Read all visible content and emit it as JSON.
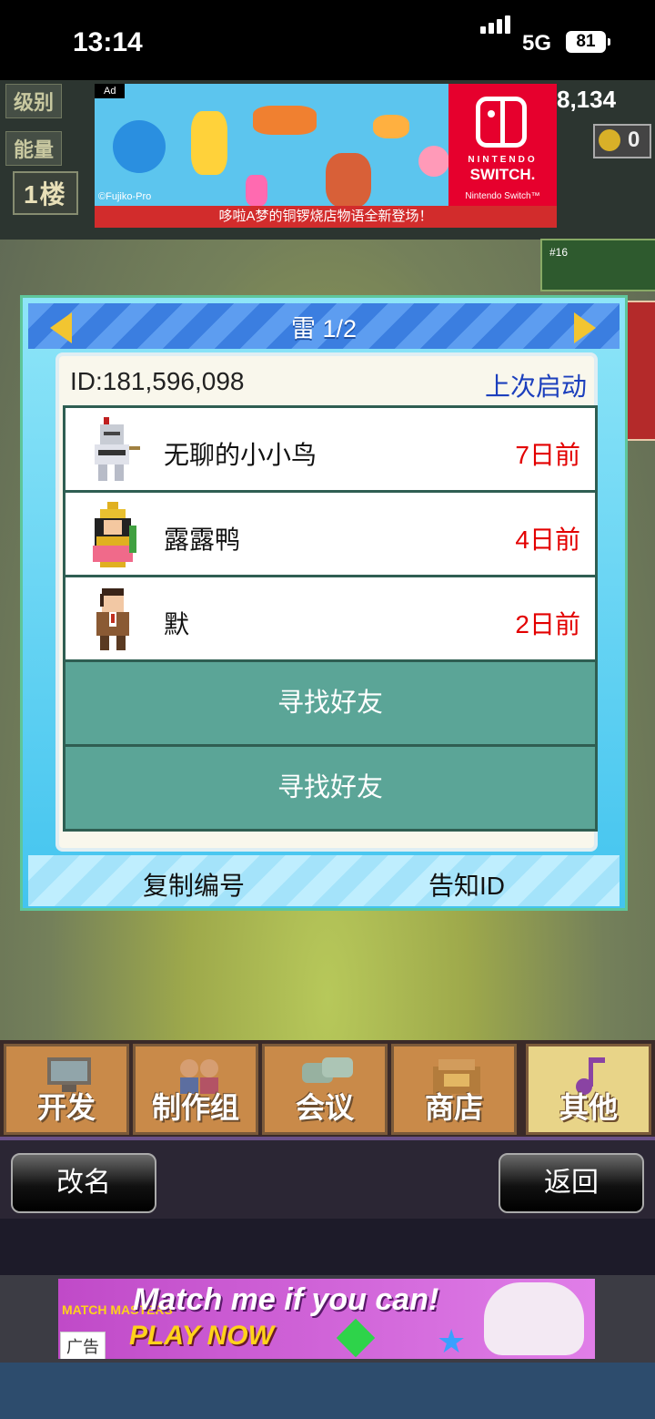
{
  "status_bar": {
    "time": "13:14",
    "network": "5G",
    "battery": "81"
  },
  "game_hud": {
    "level_label": "级别",
    "energy_label": "能量",
    "floor_label": "1楼",
    "money": "8,134",
    "coins": "0",
    "mini_badge": "#16"
  },
  "ad_top": {
    "ad_mark": "Ad",
    "copyright": "©Fujiko-Pro",
    "brand_small": "NINTENDO",
    "brand_big": "SWITCH.",
    "trademark": "Nintendo Switch™",
    "caption": "哆啦A梦的铜锣烧店物语全新登场！"
  },
  "dialog": {
    "title": "雷 1/2",
    "id_line": "ID:181,596,098",
    "sort_label": "上次启动",
    "friends": [
      {
        "name": "无聊的小小鸟",
        "last_seen": "7日前",
        "avatar": "knight-avatar-icon"
      },
      {
        "name": "露露鸭",
        "last_seen": "4日前",
        "avatar": "pharaoh-avatar-icon"
      },
      {
        "name": "默",
        "last_seen": "2日前",
        "avatar": "man-avatar-icon"
      }
    ],
    "find_buttons": [
      "寻找好友",
      "寻找好友"
    ],
    "copy_label": "复制编号",
    "share_label": "告知ID"
  },
  "menu": {
    "items": [
      {
        "label": "开发",
        "icon": "computer-icon"
      },
      {
        "label": "制作组",
        "icon": "team-icon"
      },
      {
        "label": "会议",
        "icon": "chat-icon"
      },
      {
        "label": "商店",
        "icon": "shop-icon"
      },
      {
        "label": "其他",
        "icon": "music-note-icon"
      }
    ],
    "active_index": 4
  },
  "actions": {
    "rename_label": "改名",
    "back_label": "返回"
  },
  "ad_bottom": {
    "badge": "MATCH MASTERS",
    "headline": "Match me if you can!",
    "cta": "PLAY NOW",
    "tag": "广告"
  },
  "colors": {
    "dialog_blue": "#43c4ef",
    "find_button": "#5ba597",
    "last_seen_red": "#e30000",
    "sort_label_blue": "#1c3fbd"
  }
}
